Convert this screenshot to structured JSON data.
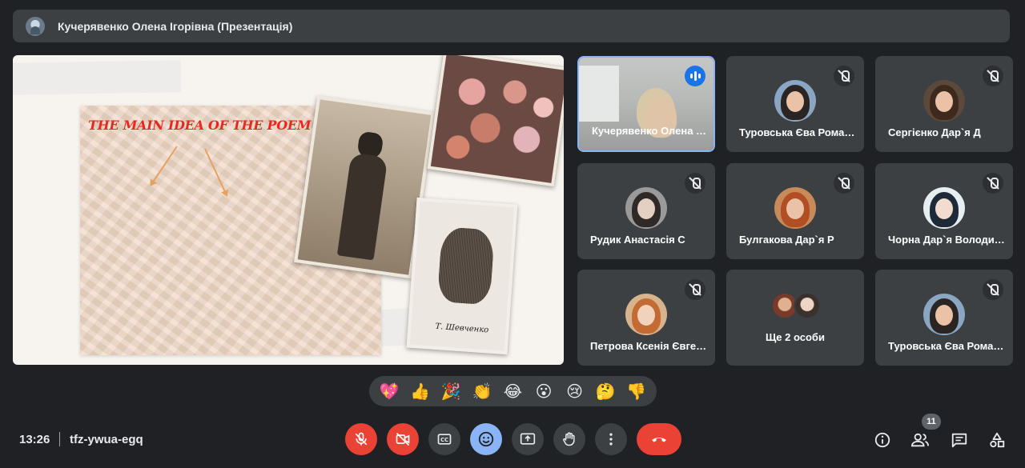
{
  "presenter_bar": {
    "title": "Кучерявенко Олена Ігорівна (Презентація)",
    "avatar_icon": "user-avatar"
  },
  "slide": {
    "title": "THE MAIN IDEA OF THE POEM",
    "signature": "Т. Шевченко"
  },
  "participants": [
    {
      "name": "Кучерявенко Олена Ігорівна",
      "state": "speaking",
      "video": true
    },
    {
      "name": "Туровська Єва Романівна",
      "state": "muted"
    },
    {
      "name": "Сергієнко Дар`я Д",
      "state": "muted"
    },
    {
      "name": "Рудик Анастасія С",
      "state": "muted"
    },
    {
      "name": "Булгакова Дар`я Р",
      "state": "muted"
    },
    {
      "name": "Чорна Дар`я Володимирівна",
      "state": "muted"
    },
    {
      "name": "Петрова Ксенія Євгенівна",
      "state": "muted"
    },
    {
      "name": "Ще 2 особи",
      "state": "group"
    },
    {
      "name": "Туровська Єва Романівна",
      "state": "muted"
    }
  ],
  "reactions": [
    "💖",
    "👍",
    "🎉",
    "👏",
    "😂",
    "😮",
    "😢",
    "🤔",
    "👎"
  ],
  "footer": {
    "time": "13:26",
    "meeting_code": "tfz-ywua-egq",
    "participant_count": "11"
  },
  "colors": {
    "background": "#202124",
    "tile": "#3c4043",
    "danger": "#ea4335",
    "accent": "#8ab4f8",
    "speaking": "#1a73e8",
    "slide_title": "#e8281d"
  },
  "controls": [
    {
      "name": "mic-off-button",
      "icon": "mic-off-icon"
    },
    {
      "name": "camera-off-button",
      "icon": "videocam-off-icon"
    },
    {
      "name": "captions-button",
      "icon": "closed-caption-icon"
    },
    {
      "name": "reactions-button",
      "icon": "emoji-icon"
    },
    {
      "name": "present-button",
      "icon": "present-screen-icon"
    },
    {
      "name": "raise-hand-button",
      "icon": "hand-icon"
    },
    {
      "name": "more-options-button",
      "icon": "more-vert-icon"
    },
    {
      "name": "leave-call-button",
      "icon": "call-end-icon"
    }
  ],
  "right_tools": [
    {
      "name": "meeting-details-button",
      "icon": "info-icon"
    },
    {
      "name": "people-button",
      "icon": "people-icon"
    },
    {
      "name": "chat-button",
      "icon": "chat-icon"
    },
    {
      "name": "activities-button",
      "icon": "shapes-icon"
    }
  ]
}
